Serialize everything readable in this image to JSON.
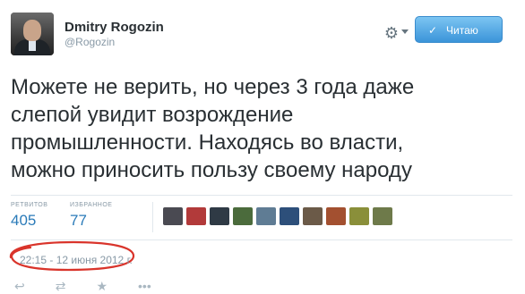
{
  "user": {
    "name": "Dmitry Rogozin",
    "handle": "@Rogozin"
  },
  "follow_button": {
    "label": "Читаю",
    "check_glyph": "✓",
    "color": "#3b94d9"
  },
  "tweet": {
    "lines": [
      "Можете не верить, но через 3 года даже",
      "слепой увидит возрождение",
      "промышленности. Находясь во власти,",
      "можно приносить пользу своему народу"
    ],
    "timestamp": "22:15 - 12 июня 2012 г."
  },
  "stats": {
    "retweets_label": "РЕТВИТОВ",
    "retweets_value": "405",
    "favorites_label": "ИЗБРАННОЕ",
    "favorites_value": "77"
  },
  "favoriters": [
    {
      "color": "#4a4a52"
    },
    {
      "color": "#b23a3a"
    },
    {
      "color": "#2f3a45"
    },
    {
      "color": "#4b6b3c"
    },
    {
      "color": "#5f7c94"
    },
    {
      "color": "#2d4f7a"
    },
    {
      "color": "#6b5a48"
    },
    {
      "color": "#a35030"
    },
    {
      "color": "#8a8f3a"
    },
    {
      "color": "#6e7a4a"
    }
  ],
  "actions": {
    "reply_glyph": "↩",
    "retweet_glyph": "⇄",
    "favorite_glyph": "★",
    "more_glyph": "•••"
  },
  "colors": {
    "link": "#2b7bb9",
    "muted": "#8899a6",
    "annotation": "#d9342b"
  },
  "icons": [
    "avatar-photo",
    "gear-icon",
    "check-icon",
    "reply-icon",
    "retweet-icon",
    "favorite-icon",
    "more-icon"
  ]
}
